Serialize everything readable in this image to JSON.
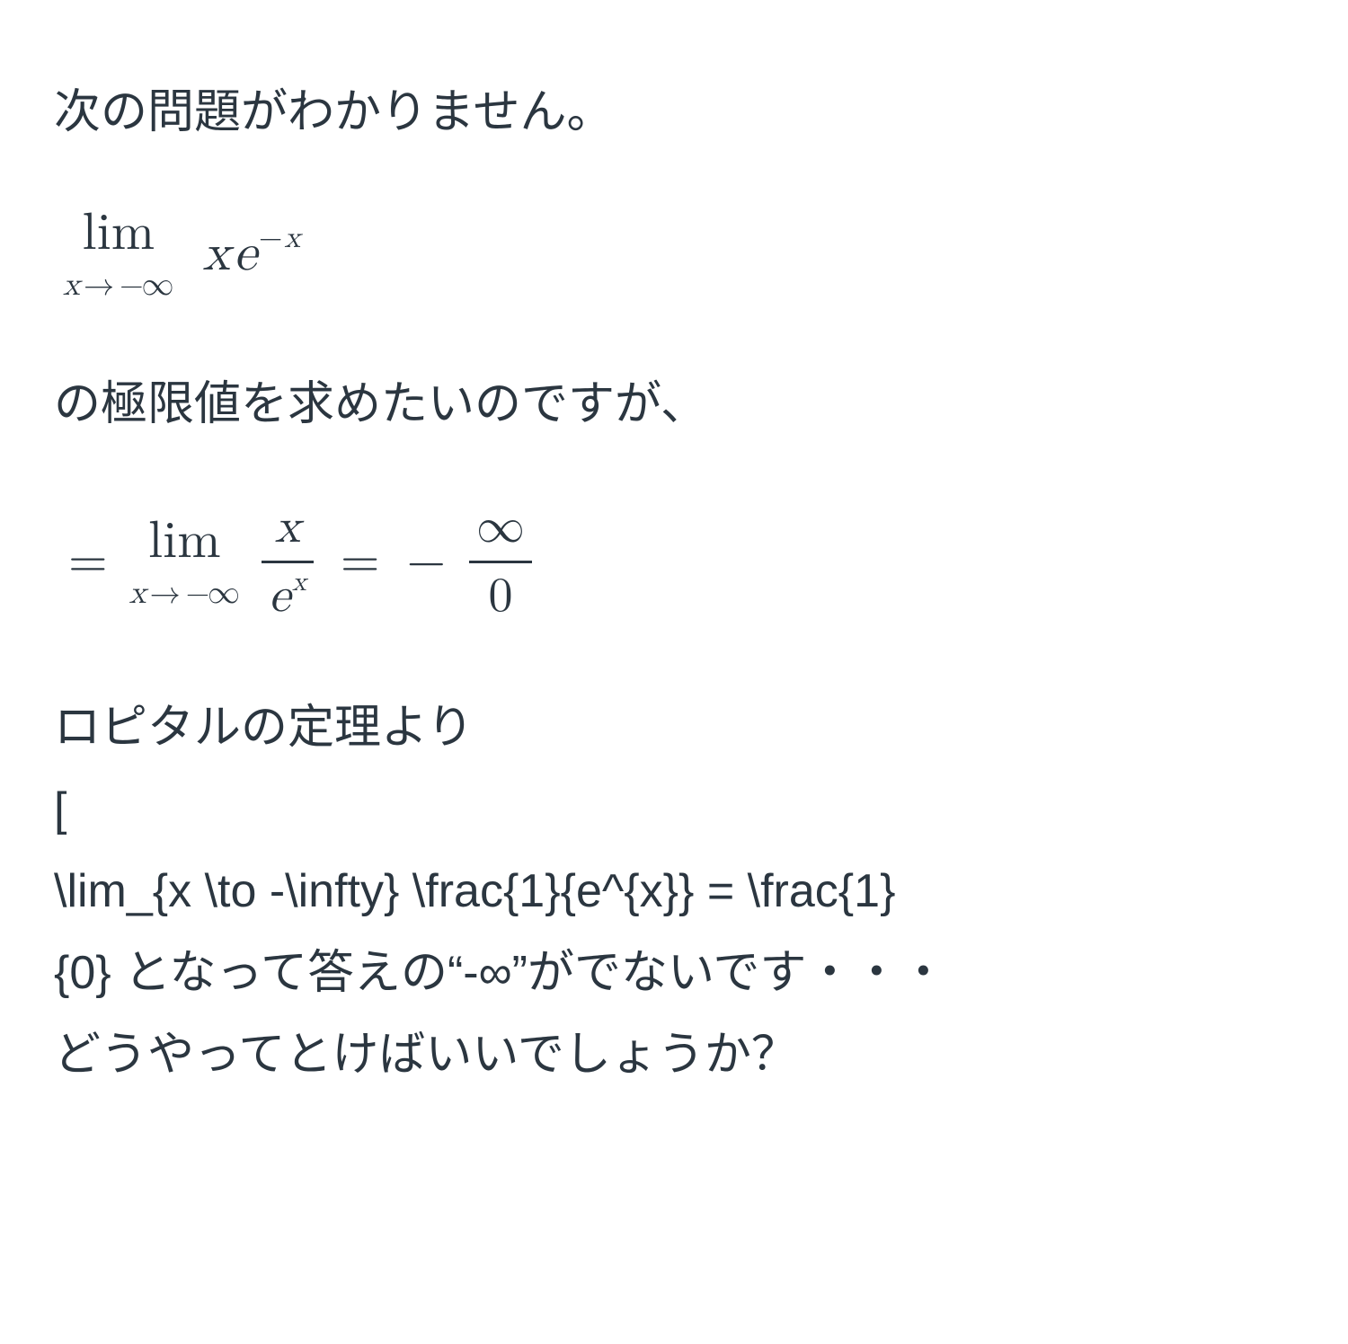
{
  "intro": "次の問題がわかりません。",
  "limit1": {
    "lim_label": "lim",
    "lim_sub_var": "x",
    "lim_sub_arrow": "→",
    "lim_sub_neg": "−",
    "lim_sub_inf": "∞",
    "expr_x": "x",
    "expr_e": "e",
    "expr_sup_neg": "−",
    "expr_sup_x": "x"
  },
  "mid_text": "の極限値を求めたいのですが、",
  "limit2": {
    "eq1": "=",
    "lim_label": "lim",
    "lim_sub_var": "x",
    "lim_sub_arrow": "→",
    "lim_sub_neg": "−",
    "lim_sub_inf": "∞",
    "frac1_num": "x",
    "frac1_den_e": "e",
    "frac1_den_x": "x",
    "eq2": "=",
    "minus": "−",
    "frac2_num_inf": "∞",
    "frac2_den_zero": "0"
  },
  "bottom": {
    "line1": "ロピタルの定理より",
    "line2": "[",
    "line3a": "\\lim_{x \\to -\\infty} \\frac{1}{e^{x}} = \\frac{1}",
    "line3b": "{0} となって答えの“-∞”がでないです・・・",
    "line4": "どうやってとけばいいでしょうか？"
  }
}
